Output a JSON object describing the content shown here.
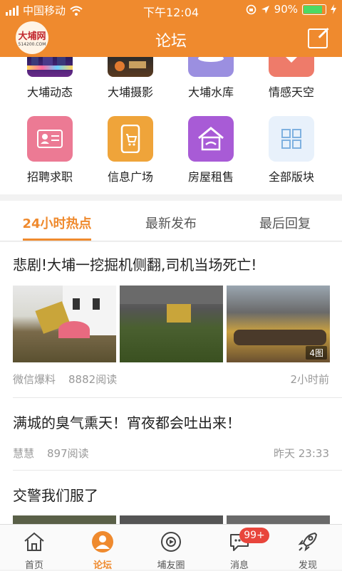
{
  "status": {
    "carrier": "中国移动",
    "time": "下午12:04",
    "battery": "90%"
  },
  "nav": {
    "title": "论坛",
    "logo_text": "大埔网",
    "logo_sub": "514200.COM"
  },
  "grid": {
    "top_row": [
      {
        "label": "大埔动态",
        "icon": "city-night-photo"
      },
      {
        "label": "大埔摄影",
        "icon": "landscape-photo"
      },
      {
        "label": "大埔水库",
        "icon": "teacup-icon"
      },
      {
        "label": "情感天空",
        "icon": "heart-icon"
      }
    ],
    "bottom_row": [
      {
        "label": "招聘求职",
        "icon": "id-card-icon",
        "color": "#ec7a94"
      },
      {
        "label": "信息广场",
        "icon": "phone-cart-icon",
        "color": "#efa43a"
      },
      {
        "label": "房屋租售",
        "icon": "house-handshake-icon",
        "color": "#a85bd6"
      },
      {
        "label": "全部版块",
        "icon": "grid-icon",
        "color": "#e8f1fb"
      }
    ]
  },
  "tabs": [
    {
      "label": "24小时热点",
      "active": true
    },
    {
      "label": "最新发布",
      "active": false
    },
    {
      "label": "最后回复",
      "active": false
    }
  ],
  "posts": [
    {
      "title": "悲剧!大埔一挖掘机侧翻,司机当场死亡!",
      "author": "微信爆料",
      "views": "8882阅读",
      "time": "2小时前",
      "image_badge": "4图"
    },
    {
      "title": "满城的臭气熏天！宵夜都会吐出来！",
      "author": "慧慧",
      "views": "897阅读",
      "time": "昨天 23:33"
    },
    {
      "title": "交警我们服了"
    }
  ],
  "tabbar": [
    {
      "label": "首页",
      "icon": "home-icon",
      "active": false
    },
    {
      "label": "论坛",
      "icon": "forum-icon",
      "active": true
    },
    {
      "label": "埔友圈",
      "icon": "circle-icon",
      "active": false
    },
    {
      "label": "消息",
      "icon": "message-icon",
      "active": false,
      "badge": "99+"
    },
    {
      "label": "发现",
      "icon": "rocket-icon",
      "active": false
    }
  ],
  "colors": {
    "accent": "#ef8a2e",
    "badge": "#e8453c"
  }
}
